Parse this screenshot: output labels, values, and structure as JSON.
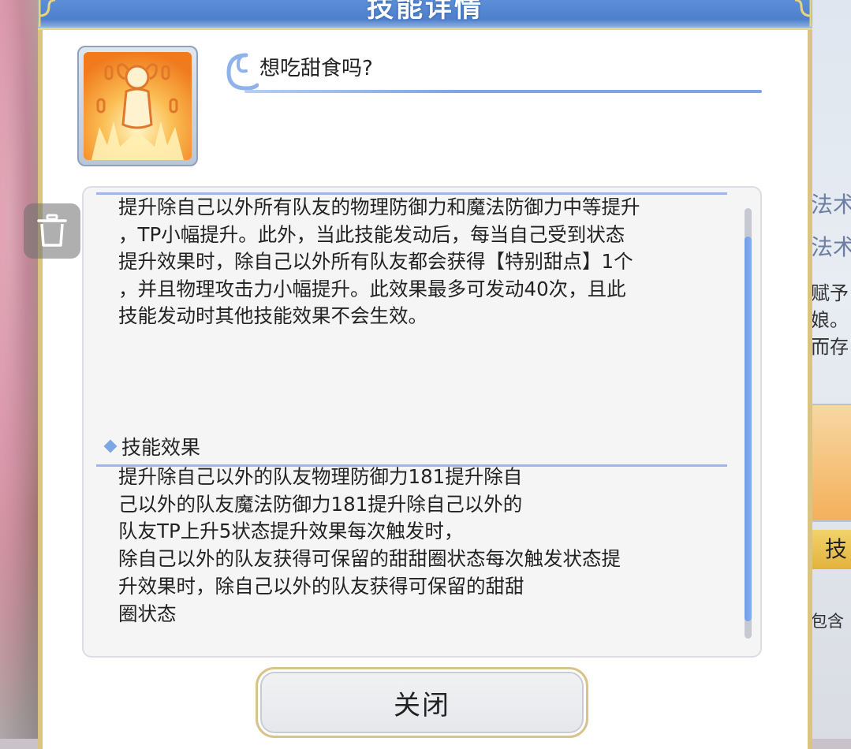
{
  "dialog": {
    "title": "技能详情"
  },
  "skill": {
    "name": "想吃甜食吗?",
    "description": "提升除自己以外所有队友的物理防御力和魔法防御力中等提升\n，TP小幅提升。此外，当此技能发动后，每当自己受到状态\n提升效果时，除自己以外所有队友都会获得【特别甜点】1个\n，并且物理攻击力小幅提升。此效果最多可发动40次，且此\n技能发动时其他技能效果不会生效。",
    "effect_heading": "技能效果",
    "effect_lines": [
      "提升除自己以外的队友物理防御力181提升除自",
      "己以外的队友魔法防御力181提升除自己以外的",
      "队友TP上升5状态提升效果每次触发时，",
      "除自己以外的队友获得可保留的甜甜圈状态每次触发状态提",
      "升效果时，除自己以外的队友获得可保留的甜甜",
      "圈状态"
    ]
  },
  "buttons": {
    "close_label": "关闭"
  },
  "background": {
    "right_labels": [
      "法术",
      "法术",
      "赋予",
      "娘。",
      "而存",
      "技",
      "包含"
    ]
  },
  "colors": {
    "header_blue": "#5d8fd8",
    "accent_blue": "#7ea6e6",
    "gold_border": "#d9c484"
  },
  "icons": {
    "skill_icon": "skill-buff-figure-icon",
    "trash": "trash-icon"
  }
}
